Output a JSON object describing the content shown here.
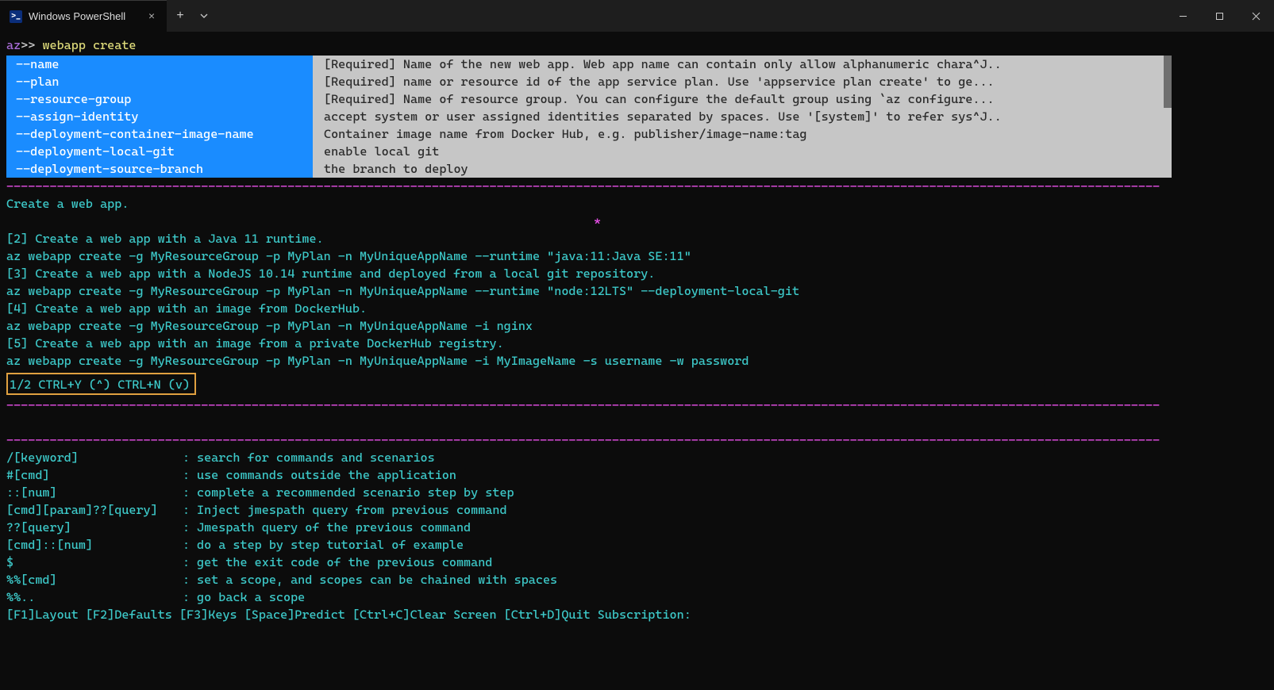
{
  "titlebar": {
    "tab_label": "Windows PowerShell",
    "ps_icon_text": ">_"
  },
  "prompt": {
    "az": "az",
    "angle": ">>",
    "command": "webapp create"
  },
  "completion": {
    "flags": [
      "--name",
      "--plan",
      "--resource-group",
      "--assign-identity",
      "--deployment-container-image-name",
      "--deployment-local-git",
      "--deployment-source-branch"
    ],
    "descs": [
      "[Required] Name of the new web app. Web app name can contain only allow alphanumeric chara^J..",
      "[Required] name or resource id of the app service plan. Use 'appservice plan create' to ge...",
      "[Required] Name of resource group. You can configure the default group using `az configure...",
      "accept system or user assigned identities separated by spaces. Use '[system]' to refer sys^J..",
      "Container image name from Docker Hub, e.g. publisher/image-name:tag",
      "enable local git",
      "the branch to deploy"
    ]
  },
  "summary_line": "Create a web app.",
  "star": "*",
  "examples": [
    "[2] Create a web app with a Java 11 runtime.",
    "az webapp create -g MyResourceGroup -p MyPlan -n MyUniqueAppName --runtime \"java:11:Java SE:11\"",
    "[3] Create a web app with a NodeJS 10.14 runtime and deployed from a local git repository.",
    "az webapp create -g MyResourceGroup -p MyPlan -n MyUniqueAppName --runtime \"node:12LTS\" --deployment-local-git",
    "[4] Create a web app with an image from DockerHub.",
    "az webapp create -g MyResourceGroup -p MyPlan -n MyUniqueAppName -i nginx",
    "[5] Create a web app with an image from a private DockerHub registry.",
    "az webapp create -g MyResourceGroup -p MyPlan -n MyUniqueAppName -i MyImageName -s username -w password"
  ],
  "paging": "1/2 CTRL+Y (^) CTRL+N (v)",
  "help": [
    {
      "k": "/[keyword]",
      "d": "search for commands and scenarios"
    },
    {
      "k": "#[cmd]",
      "d": "use commands outside the application"
    },
    {
      "k": "::[num]",
      "d": "complete a recommended scenario step by step"
    },
    {
      "k": "[cmd][param]??[query]",
      "d": "Inject jmespath query from previous command"
    },
    {
      "k": "??[query]",
      "d": "Jmespath query of the previous command"
    },
    {
      "k": "[cmd]::[num]",
      "d": "do a step by step tutorial of example"
    },
    {
      "k": "$",
      "d": "get the exit code of the previous command"
    },
    {
      "k": "%%[cmd]",
      "d": "set a scope, and scopes can be chained with spaces"
    },
    {
      "k": "%%..",
      "d": "go back a scope"
    }
  ],
  "status": "[F1]Layout [F2]Defaults [F3]Keys [Space]Predict [Ctrl+C]Clear Screen [Ctrl+D]Quit Subscription:"
}
